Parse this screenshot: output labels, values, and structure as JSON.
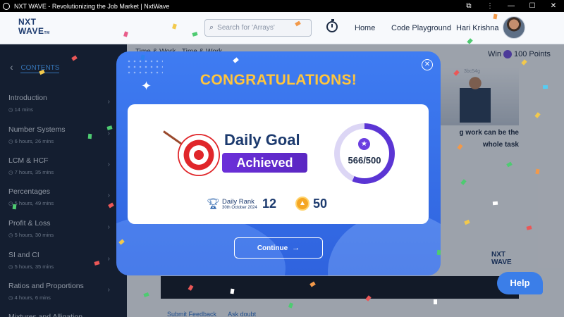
{
  "window": {
    "title": "NXT WAVE - Revolutionizing the Job Market | NxtWave"
  },
  "header": {
    "logo_line1": "NXT",
    "logo_line2": "WAVE",
    "logo_tm": "TM",
    "search_placeholder": "Search for 'Arrays'",
    "nav_home": "Home",
    "nav_code_playground": "Code Playground",
    "user_name": "Hari Krishna"
  },
  "sidebar": {
    "heading": "CONTENTS",
    "items": [
      {
        "name": "Introduction",
        "duration": "14 mins"
      },
      {
        "name": "Number Systems",
        "duration": "6 hours, 26 mins"
      },
      {
        "name": "LCM & HCF",
        "duration": "7 hours, 35 mins"
      },
      {
        "name": "Percentages",
        "duration": "5 hours, 49 mins"
      },
      {
        "name": "Profit & Loss",
        "duration": "5 hours, 30 mins"
      },
      {
        "name": "SI and CI",
        "duration": "5 hours, 35 mins"
      },
      {
        "name": "Ratios and Proportions",
        "duration": "4 hours, 6 mins"
      },
      {
        "name": "Mixtures and Alligation",
        "duration": ""
      }
    ]
  },
  "main": {
    "win_label": "Win",
    "win_points": "100 Points",
    "video_id": "3bc54g",
    "video_text": "g work can be the whole task",
    "footer_submit": "Submit Feedback",
    "footer_ask": "Ask doubt"
  },
  "modal": {
    "heading": "CONGRATULATIONS!",
    "goal_title": "Daily Goal",
    "goal_status": "Achieved",
    "progress_text": "566/500",
    "progress_fraction": 0.566,
    "rank_label": "Daily Rank",
    "rank_date": "30th October 2024",
    "rank_value": "12",
    "coins_value": "50",
    "continue_label": "Continue"
  },
  "help_label": "Help",
  "colors": {
    "modal_blue": "#3f7cf2",
    "heading_gold": "#ffc53d",
    "achieved_purple": "#6b2fd9",
    "sidebar_bg": "#172336"
  }
}
